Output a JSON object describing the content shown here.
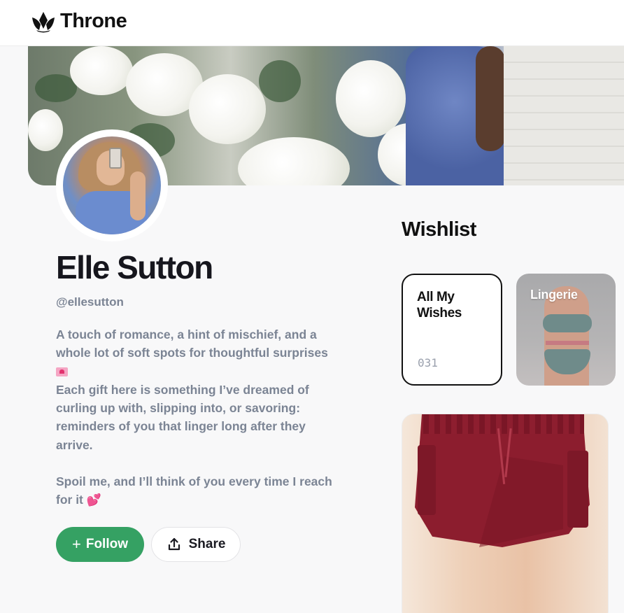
{
  "header": {
    "brand_name": "Throne",
    "logo_icon": "crown-icon"
  },
  "banner": {
    "image": "cover-photo-flowers"
  },
  "profile": {
    "name": "Elle Sutton",
    "handle": "@ellesutton",
    "bio_line1": "A touch of romance, a hint of mischief, and a whole lot of soft spots for thoughtful surprises",
    "bio_line2": "Each gift here is something I’ve dreamed of curling up with, slipping into, or savoring: reminders of you that linger long after they arrive.",
    "bio_line3": "Spoil me, and I’ll think of you every time I reach for it"
  },
  "actions": {
    "follow_icon": "+",
    "follow_label": "Follow",
    "share_label": "Share"
  },
  "wishlist": {
    "title": "Wishlist",
    "collections": [
      {
        "title": "All My Wishes",
        "count": "031"
      },
      {
        "title": "Lingerie"
      }
    ]
  },
  "colors": {
    "follow_green": "#35a163",
    "text_muted": "#7b8494",
    "text_dark": "#16161d"
  }
}
